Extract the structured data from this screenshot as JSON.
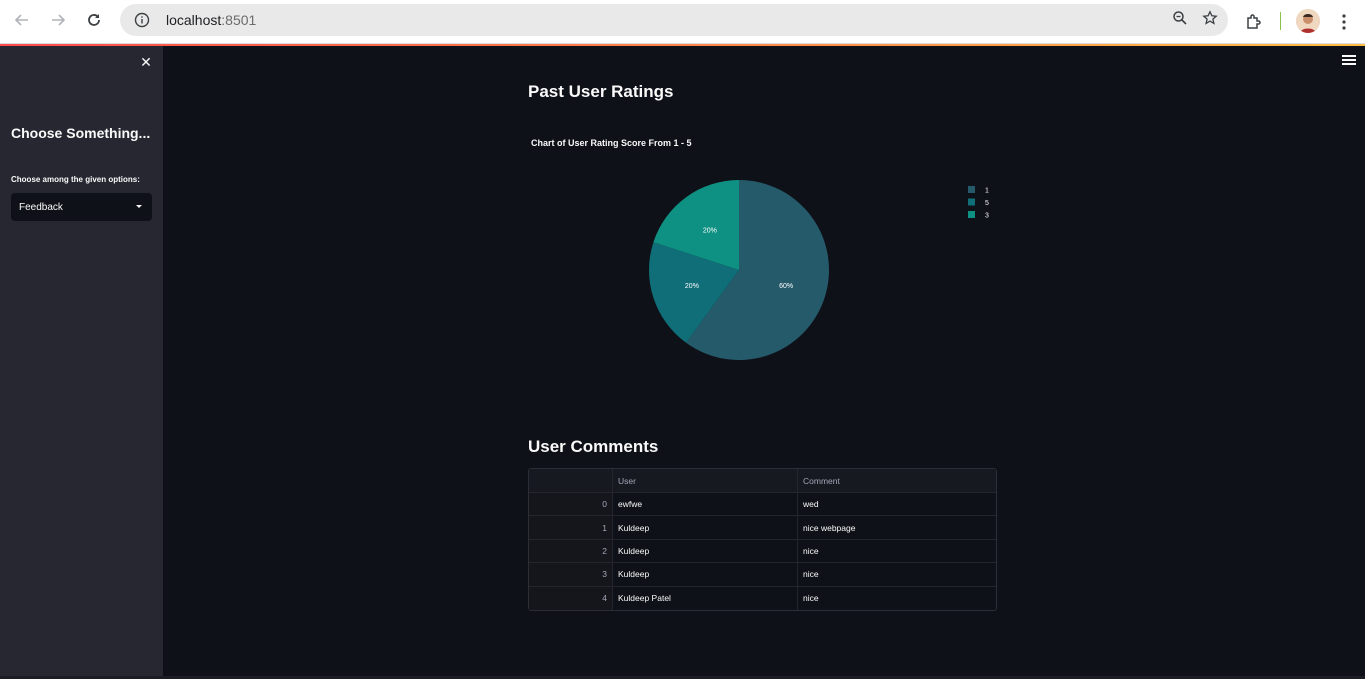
{
  "browser": {
    "url_host": "localhost",
    "url_port": ":8501"
  },
  "sidebar": {
    "title": "Choose Something...",
    "label": "Choose among the given options:",
    "select_value": "Feedback"
  },
  "main": {
    "ratings_heading": "Past User Ratings",
    "comments_heading": "User Comments"
  },
  "chart_data": {
    "type": "pie",
    "title": "Chart of User Rating Score From 1 - 5",
    "categories": [
      "1",
      "5",
      "3"
    ],
    "values": [
      60,
      20,
      20
    ],
    "labels": [
      "60%",
      "20%",
      "20%"
    ],
    "colors": [
      "#255a6b",
      "#0f6e78",
      "#0e9082"
    ],
    "legend_position": "top-right"
  },
  "table": {
    "columns": [
      "",
      "User",
      "Comment"
    ],
    "rows": [
      {
        "idx": "0",
        "user": "ewfwe",
        "comment": "wed"
      },
      {
        "idx": "1",
        "user": "Kuldeep",
        "comment": "nice webpage"
      },
      {
        "idx": "2",
        "user": "Kuldeep",
        "comment": "nice"
      },
      {
        "idx": "3",
        "user": "Kuldeep",
        "comment": "nice"
      },
      {
        "idx": "4",
        "user": "Kuldeep Patel",
        "comment": "nice"
      }
    ]
  }
}
